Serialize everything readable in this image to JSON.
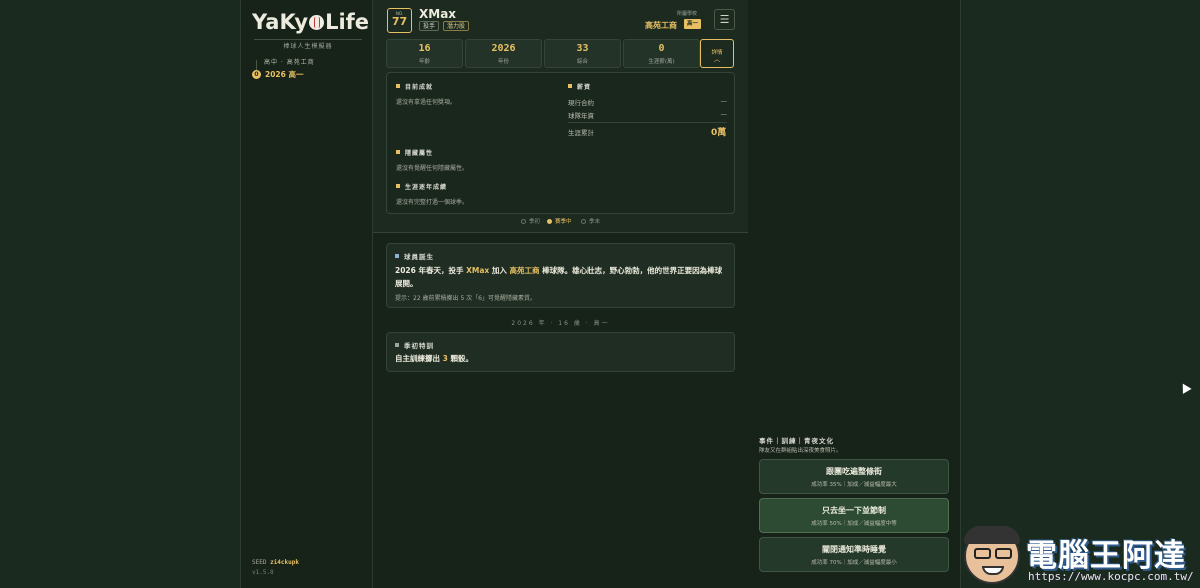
{
  "sidebar": {
    "logo": [
      "Ya",
      "Ky",
      "Life"
    ],
    "tagline": "棒球人生模擬器",
    "school_line": "高中 · 高苑工商",
    "year_marker": "0",
    "year_label": "2026 高一",
    "seed_label": "SEED",
    "seed_value": "zi4ckupk",
    "version": "v1.5.8"
  },
  "header": {
    "no_label": "NO.",
    "number": "77",
    "name": "XMax",
    "position_chip": "投手",
    "potential_chip": "潛力股",
    "team_label": "所屬學校",
    "team_name": "高苑工商",
    "grade": "高一",
    "menu_icon": "☰"
  },
  "stats": [
    {
      "value": "16",
      "label": "年齡"
    },
    {
      "value": "2026",
      "label": "年份"
    },
    {
      "value": "33",
      "label": "綜合"
    },
    {
      "value": "0",
      "label": "生涯薪(萬)"
    }
  ],
  "detail_button": {
    "label": "詳情",
    "chevron": "︿"
  },
  "info": {
    "achievements_title": "目前成就",
    "achievements_text": "還沒有拿過任何獎項。",
    "salary_title": "薪資",
    "contract_label": "現行合約",
    "contract_value": "—",
    "team_salary_label": "球隊年資",
    "team_salary_value": "—",
    "career_total_label": "生涯累計",
    "career_total_value": "0萬",
    "hidden_title": "隱藏屬性",
    "hidden_text": "還沒有覺醒任何隱藏屬性。",
    "career_title": "生涯逐年成績",
    "career_text": "還沒有完整打過一個球季。"
  },
  "phases": [
    {
      "label": "季初",
      "active": false
    },
    {
      "label": "賽季中",
      "active": true
    },
    {
      "label": "季末",
      "active": false
    }
  ],
  "feed": {
    "birth_title": "球員誕生",
    "birth_text_parts": [
      "2026 年春天，投手 ",
      "XMax",
      " 加入 ",
      "高苑工商",
      " 棒球隊。雄心壯志，野心勃勃，他的世界正要因為棒球展開。"
    ],
    "birth_hint": "提示：22 歲前累積擲出 5 次「6」可覺醒隱藏素質。",
    "divider": "2026 年 · 16 歲 · 高一",
    "training_title": "季初特訓",
    "training_text_parts": [
      "自主訓練擲出 ",
      "3",
      " 顆骰。"
    ]
  },
  "event": {
    "header": "事件｜訓練｜青夜文化",
    "subtitle": "隊友又在群組貼出深夜美食照片。",
    "choices": [
      {
        "title": "跟團吃遍整條街",
        "sub": "成功率 35%｜加成／減益幅度最大"
      },
      {
        "title": "只去坐一下並節制",
        "sub": "成功率 50%｜加成／減益幅度中等"
      },
      {
        "title": "關閉通知準時睡覺",
        "sub": "成功率 70%｜加成／減益幅度最小"
      }
    ]
  },
  "watermark": {
    "title": "電腦王阿達",
    "url": "https://www.kocpc.com.tw/"
  }
}
